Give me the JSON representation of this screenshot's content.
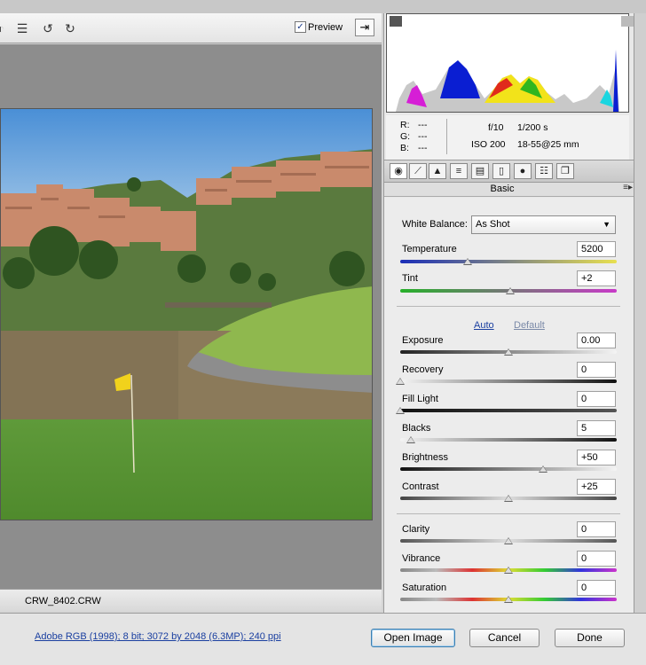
{
  "toolbar": {
    "icons": [
      "crop-icon",
      "list-icon",
      "rotate-left-icon",
      "rotate-right-icon"
    ],
    "preview_label": "Preview",
    "preview_checked": "✓"
  },
  "filename": "CRW_8402.CRW",
  "readout": {
    "r_label": "R:",
    "r_value": "---",
    "g_label": "G:",
    "g_value": "---",
    "b_label": "B:",
    "b_value": "---",
    "aperture": "f/10",
    "shutter": "1/200 s",
    "iso": "ISO 200",
    "lens": "18-55@25 mm"
  },
  "panel": {
    "title": "Basic",
    "white_balance_label": "White Balance:",
    "white_balance_value": "As Shot",
    "auto_label": "Auto",
    "default_label": "Default"
  },
  "sliders": {
    "temperature": {
      "label": "Temperature",
      "value": "5200",
      "fraction": 0.31
    },
    "tint": {
      "label": "Tint",
      "value": "+2",
      "fraction": 0.51
    },
    "exposure": {
      "label": "Exposure",
      "value": "0.00",
      "fraction": 0.5
    },
    "recovery": {
      "label": "Recovery",
      "value": "0",
      "fraction": 0.0
    },
    "fill_light": {
      "label": "Fill Light",
      "value": "0",
      "fraction": 0.0
    },
    "blacks": {
      "label": "Blacks",
      "value": "5",
      "fraction": 0.05
    },
    "brightness": {
      "label": "Brightness",
      "value": "+50",
      "fraction": 0.66
    },
    "contrast": {
      "label": "Contrast",
      "value": "+25",
      "fraction": 0.5
    },
    "clarity": {
      "label": "Clarity",
      "value": "0",
      "fraction": 0.5
    },
    "vibrance": {
      "label": "Vibrance",
      "value": "0",
      "fraction": 0.5
    },
    "saturation": {
      "label": "Saturation",
      "value": "0",
      "fraction": 0.5
    }
  },
  "bottom": {
    "workflow_link": "Adobe RGB (1998); 8 bit; 3072 by 2048 (6.3MP); 240 ppi",
    "open_label": "Open Image",
    "cancel_label": "Cancel",
    "done_label": "Done"
  }
}
